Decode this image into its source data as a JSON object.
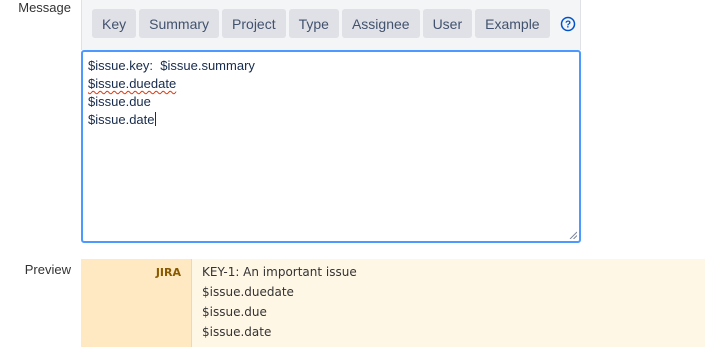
{
  "labels": {
    "message": "Message",
    "preview": "Preview"
  },
  "toolbar": {
    "tabs": [
      "Key",
      "Summary",
      "Project",
      "Type",
      "Assignee",
      "User",
      "Example"
    ],
    "help_icon": "question-circle-icon"
  },
  "editor": {
    "lines": [
      "$issue.key:  $issue.summary",
      "$issue.duedate",
      "$issue.due",
      "$issue.date"
    ],
    "spellcheck_line_index": 1
  },
  "preview": {
    "sender": "JIRA",
    "lines": [
      "KEY-1: An important issue",
      "$issue.duedate",
      "$issue.due",
      "$issue.date"
    ]
  },
  "colors": {
    "focus_border": "#4c9aff",
    "tab_bg": "#dfe1e6",
    "help_icon": "#0052cc",
    "preview_sender_bg": "#ffe9c2",
    "preview_body_bg": "#fff7e6",
    "sender_text": "#8a5a00"
  }
}
